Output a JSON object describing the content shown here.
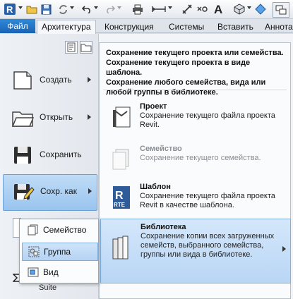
{
  "quick_access": {
    "app_logo": "R",
    "icons": [
      "open-icon",
      "save-icon",
      "sync-icon",
      "undo-icon",
      "redo-icon",
      "print-icon",
      "measure-icon",
      "dimension-icon",
      "text-icon",
      "3d-view-icon",
      "switch-windows-icon"
    ]
  },
  "ribbon": {
    "tabs": [
      {
        "label": "Файл"
      },
      {
        "label": "Архитектура"
      },
      {
        "label": "Конструкция"
      },
      {
        "label": "Системы"
      },
      {
        "label": "Вставить"
      },
      {
        "label": "Аннота"
      }
    ]
  },
  "app_menu": {
    "items": [
      {
        "label": "Создать"
      },
      {
        "label": "Открыть"
      },
      {
        "label": "Сохранить"
      },
      {
        "label": "Сохр. как"
      }
    ],
    "description_lines": [
      "Сохранение текущего проекта или семейства.",
      "Сохранение текущего проекта в виде шаблона.",
      "Сохранение любого семейства, вида или",
      "любой группы в библиотеке."
    ],
    "options": [
      {
        "title": "Проект",
        "desc": "Сохранение текущего файла проекта Revit.",
        "state": "enabled"
      },
      {
        "title": "Семейство",
        "desc": "Сохранение текущего семейства.",
        "state": "disabled"
      },
      {
        "title": "Шаблон",
        "desc": "Сохранение текущего файла проекта Revit в качестве шаблона.",
        "state": "enabled",
        "badge": "RTE"
      },
      {
        "title": "Библиотека",
        "desc": "Сохранение копии всех загруженных семейств, выбранного семейства, группы или вида в библиотеке.",
        "state": "selected"
      }
    ],
    "flyout": [
      {
        "label": "Семейство"
      },
      {
        "label": "Группа"
      },
      {
        "label": "Вид"
      }
    ],
    "partial_text": "Suite"
  },
  "colors": {
    "file_tab": "#1a63b5",
    "selection": "#b9d6f5"
  }
}
